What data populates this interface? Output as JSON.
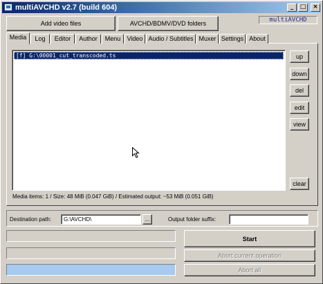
{
  "window": {
    "title": "multiAVCHD v2.7 (build 604)",
    "version_label": "multiAVCHD",
    "minimize_glyph": "_",
    "maximize_glyph": "□",
    "close_glyph": "×"
  },
  "toolbar": {
    "add_video_label": "Add video files",
    "folders_label": "AVCHD/BDMV/DVD folders"
  },
  "tabs": [
    "Media",
    "Log",
    "Editor",
    "Author",
    "Menu",
    "Video",
    "Audio / Subtitles",
    "Muxer",
    "Settings",
    "About"
  ],
  "active_tab": "Media",
  "media_list": {
    "items": [
      "[f] G:\\00001_cut_transcoded.ts"
    ],
    "selected_index": 0
  },
  "side_buttons": {
    "up": "up",
    "down": "down",
    "del": "del",
    "edit": "edit",
    "view": "view",
    "clear": "clear"
  },
  "status_text": "Media items: 1 / Size: 48 MiB (0.047 GiB) / Estimated output: ~53 MiB (0.051 GiB)",
  "destination": {
    "label": "Destination path:",
    "value": "G:\\AVCHD\\",
    "browse_label": "...",
    "suffix_label": "Output folder suffix:",
    "suffix_value": ""
  },
  "progress": {
    "bar1": 0,
    "bar2": 0,
    "bar3": 0
  },
  "actions": {
    "start": "Start",
    "abort_current": "Abort current operation",
    "abort_all": "Abort all"
  },
  "colors": {
    "selection": "#0a246a",
    "title_gradient_start": "#0a246a",
    "title_gradient_end": "#a6caf0",
    "progress_highlight": "#a6caf0"
  }
}
